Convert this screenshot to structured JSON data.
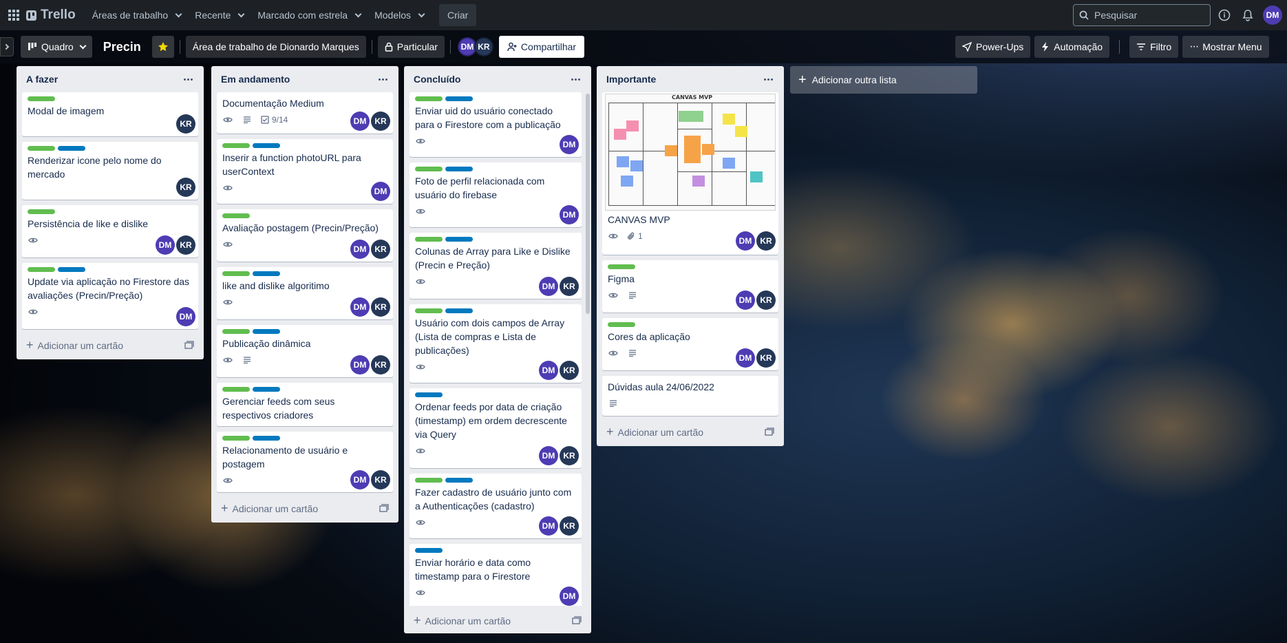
{
  "topnav": {
    "logo": "Trello",
    "menus": [
      {
        "label": "Áreas de trabalho"
      },
      {
        "label": "Recente"
      },
      {
        "label": "Marcado com estrela"
      },
      {
        "label": "Modelos"
      }
    ],
    "create": "Criar",
    "search_placeholder": "Pesquisar",
    "user_initials": "DM"
  },
  "boardbar": {
    "view": "Quadro",
    "title": "Precin",
    "workspace": "Área de trabalho de Dionardo Marques",
    "visibility": "Particular",
    "members": [
      "DM",
      "KR"
    ],
    "share": "Compartilhar",
    "powerups": "Power-Ups",
    "automation": "Automação",
    "filter": "Filtro",
    "menu": "Mostrar Menu"
  },
  "add_list": "Adicionar outra lista",
  "add_card": "Adicionar um cartão",
  "colors": {
    "green": "#61bd4f",
    "blue": "#0079bf",
    "dm": "#4d3cb3",
    "kr": "#253858"
  },
  "lists": [
    {
      "title": "A fazer",
      "cards": [
        {
          "labels": [
            "green"
          ],
          "title": "Modal de imagem",
          "members": [
            "KR"
          ]
        },
        {
          "labels": [
            "green",
            "blue"
          ],
          "title": "Renderizar icone pelo nome do mercado",
          "members": [
            "KR"
          ]
        },
        {
          "labels": [
            "green"
          ],
          "title": "Persistência de like e dislike",
          "watch": true,
          "members": [
            "DM",
            "KR"
          ]
        },
        {
          "labels": [
            "green",
            "blue"
          ],
          "title": "Update via aplicação no Firestore das avaliações (Precin/Preção)",
          "watch": true,
          "members": [
            "DM"
          ]
        }
      ]
    },
    {
      "title": "Em andamento",
      "cards": [
        {
          "labels": [],
          "title": "Documentação Medium",
          "watch": true,
          "desc": true,
          "checklist": "9/14",
          "members": [
            "DM",
            "KR"
          ]
        },
        {
          "labels": [
            "green",
            "blue"
          ],
          "title": "Inserir a function photoURL para userContext",
          "watch": true,
          "members": [
            "DM"
          ]
        },
        {
          "labels": [
            "green"
          ],
          "title": "Avaliação postagem (Precin/Preção)",
          "watch": true,
          "members": [
            "DM",
            "KR"
          ]
        },
        {
          "labels": [
            "green",
            "blue"
          ],
          "title": "like and dislike algoritimo",
          "watch": true,
          "members": [
            "DM",
            "KR"
          ]
        },
        {
          "labels": [
            "green",
            "blue"
          ],
          "title": "Publicação dinâmica",
          "watch": true,
          "desc": true,
          "members": [
            "DM",
            "KR"
          ]
        },
        {
          "labels": [
            "green",
            "blue"
          ],
          "title": "Gerenciar feeds com seus respectivos criadores",
          "members": []
        },
        {
          "labels": [
            "green",
            "blue"
          ],
          "title": "Relacionamento de usuário e postagem",
          "watch": true,
          "members": [
            "DM",
            "KR"
          ]
        }
      ]
    },
    {
      "title": "Concluído",
      "cards": [
        {
          "labels": [
            "green",
            "blue"
          ],
          "title": "Enviar uid do usuário conectado para o Firestore com a publicação",
          "watch": true,
          "members": [
            "DM"
          ]
        },
        {
          "labels": [
            "green",
            "blue"
          ],
          "title": "Foto de perfil relacionada com usuário do firebase",
          "watch": true,
          "members": [
            "DM"
          ]
        },
        {
          "labels": [
            "green",
            "blue"
          ],
          "title": "Colunas de Array para Like e Dislike (Precin e Preção)",
          "watch": true,
          "members": [
            "DM",
            "KR"
          ]
        },
        {
          "labels": [
            "green",
            "blue"
          ],
          "title": "Usuário com dois campos de Array (Lista de compras e Lista de publicações)",
          "watch": true,
          "members": [
            "DM",
            "KR"
          ]
        },
        {
          "labels": [
            "blue"
          ],
          "title": "Ordenar feeds por data de criação (timestamp) em ordem decrescente via Query",
          "watch": true,
          "members": [
            "DM",
            "KR"
          ]
        },
        {
          "labels": [
            "green",
            "blue"
          ],
          "title": "Fazer cadastro de usuário junto com a Authenticações (cadastro)",
          "watch": true,
          "members": [
            "DM",
            "KR"
          ]
        },
        {
          "labels": [
            "blue"
          ],
          "title": "Enviar horário e data como timestamp para o Firestore",
          "watch": true,
          "members": [
            "DM"
          ]
        }
      ]
    },
    {
      "title": "Importante",
      "cards": [
        {
          "labels": [],
          "cover": true,
          "cover_title": "CANVAS MVP",
          "title": "CANVAS MVP",
          "watch": true,
          "attachments": "1",
          "members": [
            "DM",
            "KR"
          ]
        },
        {
          "labels": [
            "green"
          ],
          "title": "Figma",
          "watch": true,
          "desc": true,
          "members": [
            "DM",
            "KR"
          ]
        },
        {
          "labels": [
            "green"
          ],
          "title": "Cores da aplicação",
          "watch": true,
          "desc": true,
          "members": [
            "DM",
            "KR"
          ]
        },
        {
          "labels": [],
          "title": "Dúvidas aula 24/06/2022",
          "desc": true,
          "members": []
        }
      ]
    }
  ]
}
